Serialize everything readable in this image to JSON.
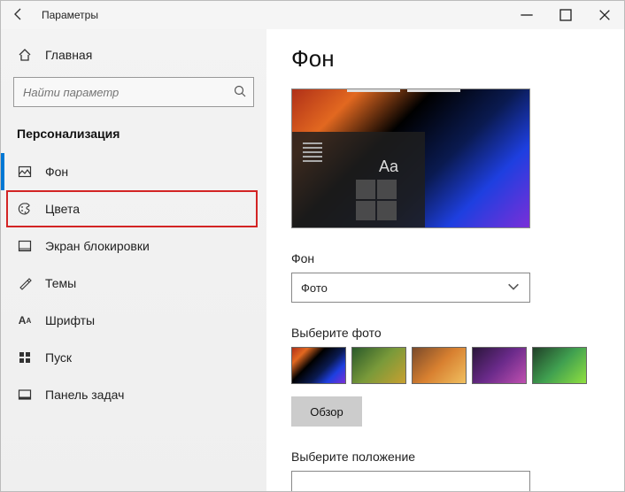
{
  "window": {
    "title": "Параметры"
  },
  "sidebar": {
    "home": "Главная",
    "search_placeholder": "Найти параметр",
    "section": "Персонализация",
    "items": [
      {
        "label": "Фон"
      },
      {
        "label": "Цвета"
      },
      {
        "label": "Экран блокировки"
      },
      {
        "label": "Темы"
      },
      {
        "label": "Шрифты"
      },
      {
        "label": "Пуск"
      },
      {
        "label": "Панель задач"
      }
    ]
  },
  "content": {
    "heading": "Фон",
    "preview_sample_text": "Aa",
    "bg_label": "Фон",
    "bg_value": "Фото",
    "choose_photo_label": "Выберите фото",
    "browse_button": "Обзор",
    "position_label": "Выберите положение"
  }
}
